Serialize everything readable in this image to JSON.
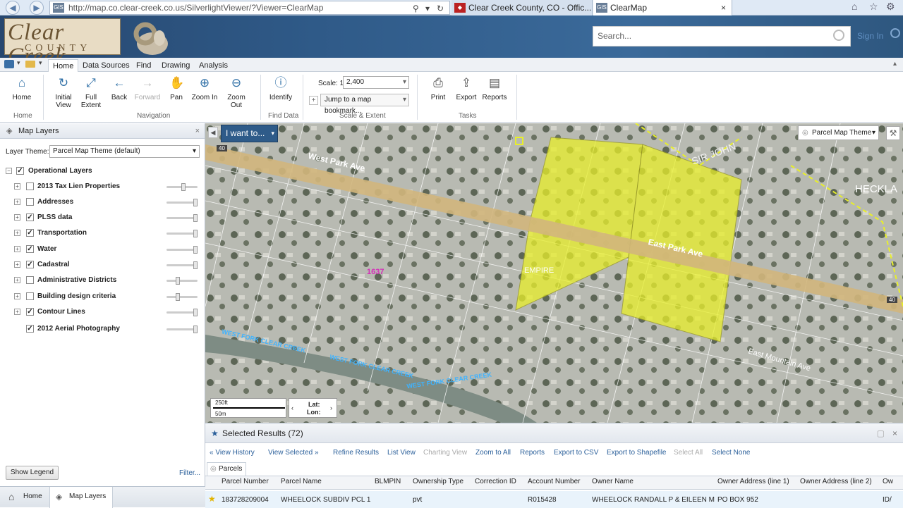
{
  "browser": {
    "url": "http://map.co.clear-creek.co.us/SilverlightViewer/?Viewer=ClearMap",
    "tab1": "Clear Creek County, CO - Offic...",
    "tab2": "ClearMap",
    "close": "×"
  },
  "header": {
    "logo_line1": "Clear Creek",
    "logo_line2": "COUNTY",
    "search_placeholder": "Search...",
    "signin": "Sign In"
  },
  "ribbon": {
    "tabs": [
      "Home",
      "Data Sources",
      "Find",
      "Drawing",
      "Analysis"
    ],
    "home_btn": "Home",
    "home_group": "Home",
    "initial_view": "Initial View",
    "full_extent": "Full Extent",
    "back": "Back",
    "forward": "Forward",
    "pan": "Pan",
    "zoom_in": "Zoom In",
    "zoom_out": "Zoom Out",
    "navigation_group": "Navigation",
    "identify": "Identify",
    "find_data_group": "Find Data",
    "scale_label": "Scale: 1:",
    "scale_value": "2,400",
    "bookmark": "Jump to a map bookmark...",
    "scale_group": "Scale & Extent",
    "print": "Print",
    "export": "Export",
    "reports": "Reports",
    "tasks_group": "Tasks"
  },
  "left_panel": {
    "title": "Map Layers",
    "theme_label": "Layer Theme:",
    "theme_value": "Parcel Map Theme (default)",
    "root": "Operational Layers",
    "layers": [
      {
        "name": "2013 Tax Lien Properties",
        "checked": false,
        "opacity": 0.55
      },
      {
        "name": "Addresses",
        "checked": false,
        "opacity": 1
      },
      {
        "name": "PLSS data",
        "checked": true,
        "opacity": 1
      },
      {
        "name": "Transportation",
        "checked": true,
        "opacity": 1
      },
      {
        "name": "Water",
        "checked": true,
        "opacity": 1
      },
      {
        "name": "Cadastral",
        "checked": true,
        "opacity": 1
      },
      {
        "name": "Administrative Districts",
        "checked": false,
        "opacity": 0.35
      },
      {
        "name": "Building design criteria",
        "checked": false,
        "opacity": 0.35
      },
      {
        "name": "Contour Lines",
        "checked": true,
        "opacity": 1
      },
      {
        "name": "2012 Aerial Photography",
        "checked": true,
        "opacity": 1
      }
    ],
    "show_legend": "Show Legend",
    "filter": "Filter...",
    "tab_home": "Home",
    "tab_map_layers": "Map Layers"
  },
  "map": {
    "i_want_to": "I want to...",
    "theme_btn": "Parcel Map Theme",
    "labels": {
      "west_park": "West Park Ave",
      "east_park": "East Park Ave",
      "sir_john": "SIR JOHN",
      "heckla": "HECKLA",
      "empire": "EMPIRE",
      "east_mountain": "East Mountain Ave",
      "west_fork1": "WEST FORK CLEAR CREEK",
      "west_fork2": "WEST FORK CLEAR CREEK",
      "west_fork3": "WEST FORK CLEAR CREEK",
      "parcel_1637": "1637",
      "hwy40a": "40",
      "hwy40b": "40"
    },
    "scale_ft": "250ft",
    "scale_m": "50m",
    "lat": "Lat:",
    "lon": "Lon:"
  },
  "results": {
    "title": "Selected Results (72)",
    "actions": [
      "View History",
      "View Selected",
      "Refine Results",
      "List View",
      "Charting View",
      "Zoom to All",
      "Reports",
      "Export to CSV",
      "Export to Shapefile",
      "Select All",
      "Select None"
    ],
    "tab": "Parcels",
    "columns": [
      "Parcel Number",
      "Parcel Name",
      "BLMPIN",
      "Ownership Type",
      "Correction ID",
      "Account Number",
      "Owner Name",
      "Owner Address (line 1)",
      "Owner Address (line 2)",
      "Ow"
    ],
    "row": [
      "183728209004",
      "WHEELOCK SUBDIV PCL 1",
      "",
      "pvt",
      "",
      "R015428",
      "WHEELOCK RANDALL P & EILEEN M",
      "PO BOX 952",
      "",
      "ID/"
    ]
  }
}
